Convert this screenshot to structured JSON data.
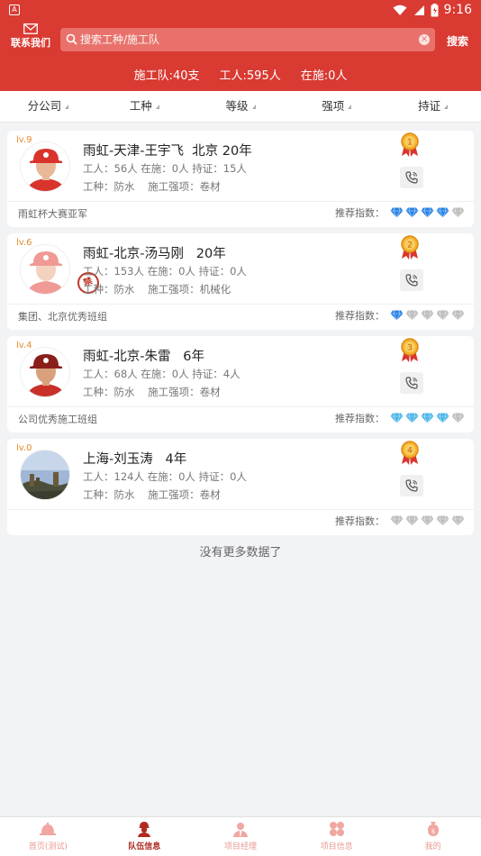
{
  "status_bar": {
    "time": "9:16",
    "app_glyph": "A"
  },
  "header": {
    "contact_label": "联系我们",
    "search_placeholder": "搜索工种/施工队",
    "search_button": "搜索"
  },
  "summary": {
    "teams": "施工队:40支",
    "workers": "工人:595人",
    "on_site": "在施:0人"
  },
  "filters": [
    "分公司",
    "工种",
    "等级",
    "强项",
    "持证"
  ],
  "teams": [
    {
      "level": "lv.9",
      "name": "雨虹-天津-王宇飞  北京 20年",
      "stats": "工人：56人 在施：0人 持证：15人",
      "skills": "工种：防水    施工强项：卷材",
      "honor": "雨虹杯大赛亚军",
      "rank": "1",
      "rec_label": "推荐指数：",
      "rating": 4,
      "gem_color": "#2a84e6",
      "avatar": "worker-red-helmet",
      "stamp": ""
    },
    {
      "level": "lv.6",
      "name": "雨虹-北京-汤马刚   20年",
      "stats": "工人：153人 在施：0人 持证：0人",
      "skills": "工种：防水    施工强项：机械化",
      "honor": "集团、北京优秀班组",
      "rank": "2",
      "rec_label": "推荐指数：",
      "rating": 1,
      "gem_color": "#2a84e6",
      "avatar": "worker-faded",
      "stamp": "禁"
    },
    {
      "level": "lv.4",
      "name": "雨虹-北京-朱雷   6年",
      "stats": "工人：68人 在施：0人 持证：4人",
      "skills": "工种：防水    施工强项：卷材",
      "honor": "公司优秀施工班组",
      "rank": "3",
      "rec_label": "推荐指数：",
      "rating": 4,
      "gem_color": "#4ab6e8",
      "avatar": "worker-dark-helmet",
      "stamp": ""
    },
    {
      "level": "lv.0",
      "name": "上海-刘玉涛   4年",
      "stats": "工人：124人 在施：0人 持证：0人",
      "skills": "工种：防水    施工强项：卷材",
      "honor": "",
      "rank": "4",
      "rec_label": "推荐指数：",
      "rating": 0,
      "gem_color": "#888888",
      "avatar": "landscape-photo",
      "stamp": ""
    }
  ],
  "no_more": "没有更多数据了",
  "tabs": [
    {
      "label": "首页(测试)",
      "icon": "home-icon"
    },
    {
      "label": "队伍信息",
      "icon": "team-icon",
      "active": true
    },
    {
      "label": "项目经理",
      "icon": "manager-icon"
    },
    {
      "label": "项目信息",
      "icon": "project-icon"
    },
    {
      "label": "我的",
      "icon": "wallet-icon"
    }
  ],
  "colors": {
    "brand": "#d93a32",
    "level": "#e58b2a",
    "gem_off": "#bdbdbd"
  }
}
